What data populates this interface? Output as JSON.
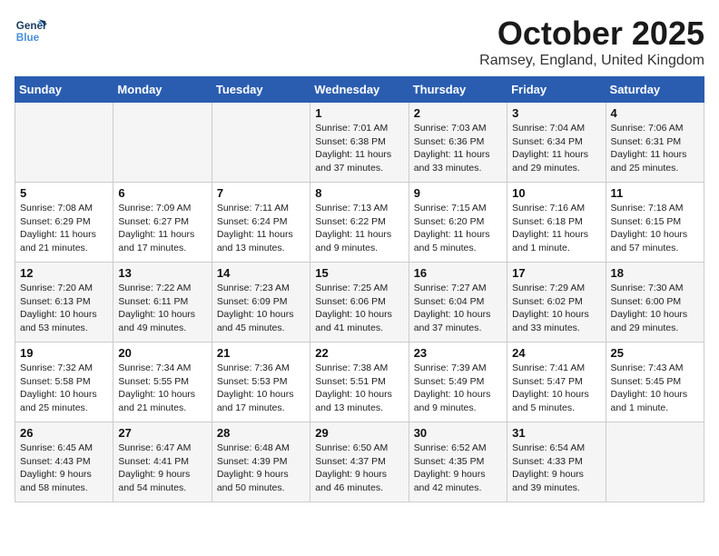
{
  "logo": {
    "line1": "General",
    "line2": "Blue"
  },
  "title": "October 2025",
  "location": "Ramsey, England, United Kingdom",
  "days_of_week": [
    "Sunday",
    "Monday",
    "Tuesday",
    "Wednesday",
    "Thursday",
    "Friday",
    "Saturday"
  ],
  "weeks": [
    [
      {
        "day": "",
        "info": ""
      },
      {
        "day": "",
        "info": ""
      },
      {
        "day": "",
        "info": ""
      },
      {
        "day": "1",
        "info": "Sunrise: 7:01 AM\nSunset: 6:38 PM\nDaylight: 11 hours\nand 37 minutes."
      },
      {
        "day": "2",
        "info": "Sunrise: 7:03 AM\nSunset: 6:36 PM\nDaylight: 11 hours\nand 33 minutes."
      },
      {
        "day": "3",
        "info": "Sunrise: 7:04 AM\nSunset: 6:34 PM\nDaylight: 11 hours\nand 29 minutes."
      },
      {
        "day": "4",
        "info": "Sunrise: 7:06 AM\nSunset: 6:31 PM\nDaylight: 11 hours\nand 25 minutes."
      }
    ],
    [
      {
        "day": "5",
        "info": "Sunrise: 7:08 AM\nSunset: 6:29 PM\nDaylight: 11 hours\nand 21 minutes."
      },
      {
        "day": "6",
        "info": "Sunrise: 7:09 AM\nSunset: 6:27 PM\nDaylight: 11 hours\nand 17 minutes."
      },
      {
        "day": "7",
        "info": "Sunrise: 7:11 AM\nSunset: 6:24 PM\nDaylight: 11 hours\nand 13 minutes."
      },
      {
        "day": "8",
        "info": "Sunrise: 7:13 AM\nSunset: 6:22 PM\nDaylight: 11 hours\nand 9 minutes."
      },
      {
        "day": "9",
        "info": "Sunrise: 7:15 AM\nSunset: 6:20 PM\nDaylight: 11 hours\nand 5 minutes."
      },
      {
        "day": "10",
        "info": "Sunrise: 7:16 AM\nSunset: 6:18 PM\nDaylight: 11 hours\nand 1 minute."
      },
      {
        "day": "11",
        "info": "Sunrise: 7:18 AM\nSunset: 6:15 PM\nDaylight: 10 hours\nand 57 minutes."
      }
    ],
    [
      {
        "day": "12",
        "info": "Sunrise: 7:20 AM\nSunset: 6:13 PM\nDaylight: 10 hours\nand 53 minutes."
      },
      {
        "day": "13",
        "info": "Sunrise: 7:22 AM\nSunset: 6:11 PM\nDaylight: 10 hours\nand 49 minutes."
      },
      {
        "day": "14",
        "info": "Sunrise: 7:23 AM\nSunset: 6:09 PM\nDaylight: 10 hours\nand 45 minutes."
      },
      {
        "day": "15",
        "info": "Sunrise: 7:25 AM\nSunset: 6:06 PM\nDaylight: 10 hours\nand 41 minutes."
      },
      {
        "day": "16",
        "info": "Sunrise: 7:27 AM\nSunset: 6:04 PM\nDaylight: 10 hours\nand 37 minutes."
      },
      {
        "day": "17",
        "info": "Sunrise: 7:29 AM\nSunset: 6:02 PM\nDaylight: 10 hours\nand 33 minutes."
      },
      {
        "day": "18",
        "info": "Sunrise: 7:30 AM\nSunset: 6:00 PM\nDaylight: 10 hours\nand 29 minutes."
      }
    ],
    [
      {
        "day": "19",
        "info": "Sunrise: 7:32 AM\nSunset: 5:58 PM\nDaylight: 10 hours\nand 25 minutes."
      },
      {
        "day": "20",
        "info": "Sunrise: 7:34 AM\nSunset: 5:55 PM\nDaylight: 10 hours\nand 21 minutes."
      },
      {
        "day": "21",
        "info": "Sunrise: 7:36 AM\nSunset: 5:53 PM\nDaylight: 10 hours\nand 17 minutes."
      },
      {
        "day": "22",
        "info": "Sunrise: 7:38 AM\nSunset: 5:51 PM\nDaylight: 10 hours\nand 13 minutes."
      },
      {
        "day": "23",
        "info": "Sunrise: 7:39 AM\nSunset: 5:49 PM\nDaylight: 10 hours\nand 9 minutes."
      },
      {
        "day": "24",
        "info": "Sunrise: 7:41 AM\nSunset: 5:47 PM\nDaylight: 10 hours\nand 5 minutes."
      },
      {
        "day": "25",
        "info": "Sunrise: 7:43 AM\nSunset: 5:45 PM\nDaylight: 10 hours\nand 1 minute."
      }
    ],
    [
      {
        "day": "26",
        "info": "Sunrise: 6:45 AM\nSunset: 4:43 PM\nDaylight: 9 hours\nand 58 minutes."
      },
      {
        "day": "27",
        "info": "Sunrise: 6:47 AM\nSunset: 4:41 PM\nDaylight: 9 hours\nand 54 minutes."
      },
      {
        "day": "28",
        "info": "Sunrise: 6:48 AM\nSunset: 4:39 PM\nDaylight: 9 hours\nand 50 minutes."
      },
      {
        "day": "29",
        "info": "Sunrise: 6:50 AM\nSunset: 4:37 PM\nDaylight: 9 hours\nand 46 minutes."
      },
      {
        "day": "30",
        "info": "Sunrise: 6:52 AM\nSunset: 4:35 PM\nDaylight: 9 hours\nand 42 minutes."
      },
      {
        "day": "31",
        "info": "Sunrise: 6:54 AM\nSunset: 4:33 PM\nDaylight: 9 hours\nand 39 minutes."
      },
      {
        "day": "",
        "info": ""
      }
    ]
  ]
}
